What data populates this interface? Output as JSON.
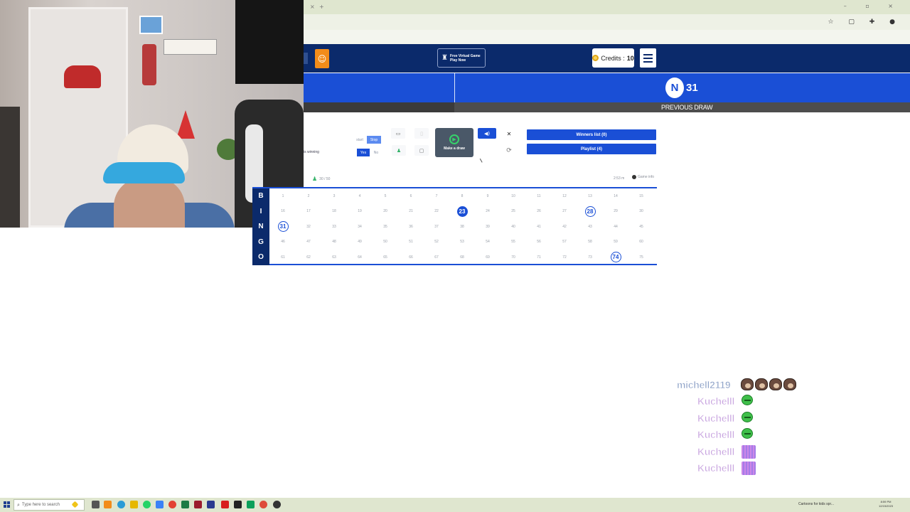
{
  "browser": {
    "tab_close": "×",
    "new_tab": "+",
    "window_controls": "– ▫ ×"
  },
  "header": {
    "virtual_game_line1": "Free Virtual Game",
    "virtual_game_line2": "Play Now",
    "credits_label": "Credits : ",
    "credits_value": "10"
  },
  "draw": {
    "ball_letter": "N",
    "ball_number": "31",
    "previous_draw_label": "PREVIOUS DRAW"
  },
  "controls": {
    "winning_label": "is winning",
    "start_label": "start",
    "stop_label": "Stop",
    "yes_label": "Yes",
    "no_label": "No",
    "make_draw_label": "Make a draw",
    "winners_list_label": "Winners list (0)",
    "playlist_label": "Playlist (4)"
  },
  "status": {
    "players_count": "30 / 50",
    "timer": "2:53 m",
    "game_info_label": "Game info"
  },
  "board": {
    "rows": [
      {
        "letter": "B",
        "numbers": [
          "1",
          "2",
          "3",
          "4",
          "5",
          "6",
          "7",
          "8",
          "9",
          "10",
          "11",
          "12",
          "13",
          "14",
          "15"
        ]
      },
      {
        "letter": "I",
        "numbers": [
          "16",
          "17",
          "18",
          "19",
          "20",
          "21",
          "22",
          "23",
          "24",
          "25",
          "26",
          "27",
          "28",
          "29",
          "30"
        ]
      },
      {
        "letter": "N",
        "numbers": [
          "31",
          "32",
          "33",
          "34",
          "35",
          "36",
          "37",
          "38",
          "39",
          "40",
          "41",
          "42",
          "43",
          "44",
          "45"
        ]
      },
      {
        "letter": "G",
        "numbers": [
          "46",
          "47",
          "48",
          "49",
          "50",
          "51",
          "52",
          "53",
          "54",
          "55",
          "56",
          "57",
          "58",
          "59",
          "60"
        ]
      },
      {
        "letter": "O",
        "numbers": [
          "61",
          "62",
          "63",
          "64",
          "65",
          "66",
          "67",
          "68",
          "69",
          "70",
          "71",
          "72",
          "73",
          "74",
          "75"
        ]
      }
    ],
    "called_filled": [
      "23"
    ],
    "called_outlined": [
      "28",
      "74",
      "31"
    ]
  },
  "chat": [
    {
      "user": "michell2119",
      "color": "#8fa3c8",
      "emotes": [
        "bear",
        "bear",
        "bear",
        "bear"
      ]
    },
    {
      "user": "Kuchelll",
      "color": "#c9a6e0",
      "emotes": [
        "pepe"
      ]
    },
    {
      "user": "Kuchelll",
      "color": "#c9a6e0",
      "emotes": [
        "pepe"
      ]
    },
    {
      "user": "Kuchelll",
      "color": "#c9a6e0",
      "emotes": [
        "pepe"
      ]
    },
    {
      "user": "Kuchelll",
      "color": "#c9a6e0",
      "emotes": [
        "dots"
      ]
    },
    {
      "user": "Kuchelll",
      "color": "#c9a6e0",
      "emotes": [
        "dots"
      ]
    }
  ],
  "taskbar": {
    "search_placeholder": "Type here to search",
    "tray_text": "Cartoons for kids spr...",
    "clock_time": "8:59 PM",
    "clock_date": "12/15/2023"
  },
  "colors": {
    "accent": "#1a4fd6",
    "header_navy": "#0b2a6b",
    "orange": "#f28c1a"
  }
}
